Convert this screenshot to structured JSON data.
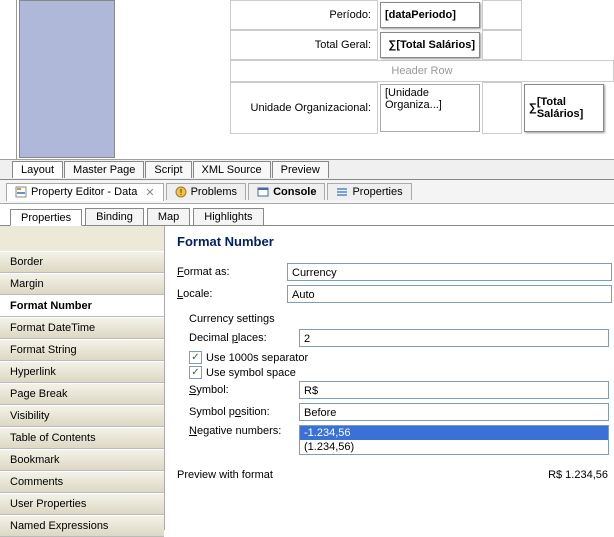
{
  "design": {
    "row1_label": "Período:",
    "row1_value": "[dataPeriodo]",
    "row2_label": "Total Geral:",
    "row2_value_prefix": "∑",
    "row2_value": "[Total Salários]",
    "header_row": "Header Row",
    "row3_label": "Unidade Organizacional:",
    "row3_value": "[Unidade Organiza...]",
    "row3_total": "[Total Salários]"
  },
  "lower_tabs": [
    "Layout",
    "Master Page",
    "Script",
    "XML Source",
    "Preview"
  ],
  "editor_tabs": [
    {
      "label": "Property Editor - Data",
      "active": true,
      "closable": true
    },
    {
      "label": "Problems",
      "active": false
    },
    {
      "label": "Console",
      "active": false
    },
    {
      "label": "Properties",
      "active": false
    }
  ],
  "inspector_tabs": [
    "Properties",
    "Binding",
    "Map",
    "Highlights"
  ],
  "sidebar_items": [
    "Border",
    "Margin",
    "Format Number",
    "Format DateTime",
    "Format String",
    "Hyperlink",
    "Page Break",
    "Visibility",
    "Table of Contents",
    "Bookmark",
    "Comments",
    "User Properties",
    "Named Expressions"
  ],
  "sidebar_active": "Format Number",
  "panel": {
    "title": "Format Number",
    "format_as_label": "Format as:",
    "format_as_value": "Currency",
    "locale_label": "Locale:",
    "locale_value": "Auto",
    "currency_heading": "Currency settings",
    "decimal_label": "Decimal places:",
    "decimal_value": "2",
    "use_1000s_label": "Use 1000s separator",
    "use_symbol_space_label": "Use symbol space",
    "symbol_label": "Symbol:",
    "symbol_value": "R$",
    "symbol_pos_label": "Symbol position:",
    "symbol_pos_value": "Before",
    "negative_label": "Negative numbers:",
    "negative_options": [
      "-1.234,56",
      "(1.234,56)"
    ],
    "preview_label": "Preview with format",
    "preview_value": "R$ 1.234,56"
  }
}
